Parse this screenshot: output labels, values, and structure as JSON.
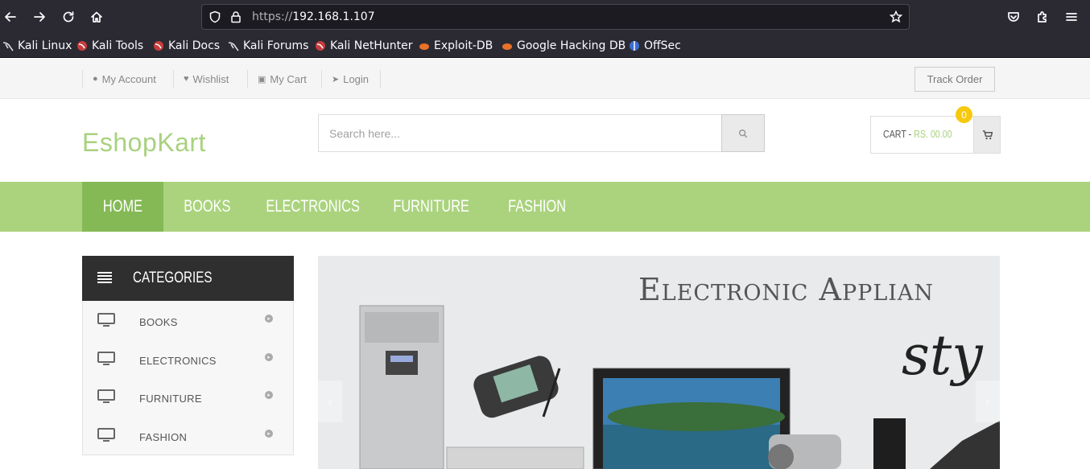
{
  "browser": {
    "url_scheme": "https://",
    "url_host": "192.168.1.107",
    "bookmarks": [
      {
        "label": "Kali Linux",
        "icon": "kali-dragon-icon"
      },
      {
        "label": "Kali Tools",
        "icon": "kali-tools-icon"
      },
      {
        "label": "Kali Docs",
        "icon": "kali-docs-icon"
      },
      {
        "label": "Kali Forums",
        "icon": "kali-dragon-icon"
      },
      {
        "label": "Kali NetHunter",
        "icon": "kali-nethunter-icon"
      },
      {
        "label": "Exploit-DB",
        "icon": "exploit-db-icon"
      },
      {
        "label": "Google Hacking DB",
        "icon": "exploit-db-icon"
      },
      {
        "label": "OffSec",
        "icon": "offsec-icon"
      }
    ]
  },
  "topbar": {
    "my_account": "My Account",
    "wishlist": "Wishlist",
    "my_cart": "My Cart",
    "login": "Login",
    "track_order": "Track Order"
  },
  "header": {
    "logo": "EshopKart",
    "search_placeholder": "Search here...",
    "cart_label": "CART - ",
    "cart_amount": "RS. 00.00",
    "cart_count": "0"
  },
  "nav": {
    "home": "HOME",
    "books": "BOOKS",
    "electronics": "ELECTRONICS",
    "furniture": "FURNITURE",
    "fashion": "FASHION"
  },
  "categories": {
    "title": "CATEGORIES",
    "items": [
      {
        "label": "BOOKS"
      },
      {
        "label": "ELECTRONICS"
      },
      {
        "label": "FURNITURE"
      },
      {
        "label": "FASHION"
      }
    ]
  },
  "banner": {
    "title": "Electronic Applian",
    "script": "sty"
  },
  "colors": {
    "accent_green": "#abd37e",
    "active_green": "#84b955",
    "badge_yellow": "#f6c90e",
    "category_header": "#2f2f2f"
  }
}
